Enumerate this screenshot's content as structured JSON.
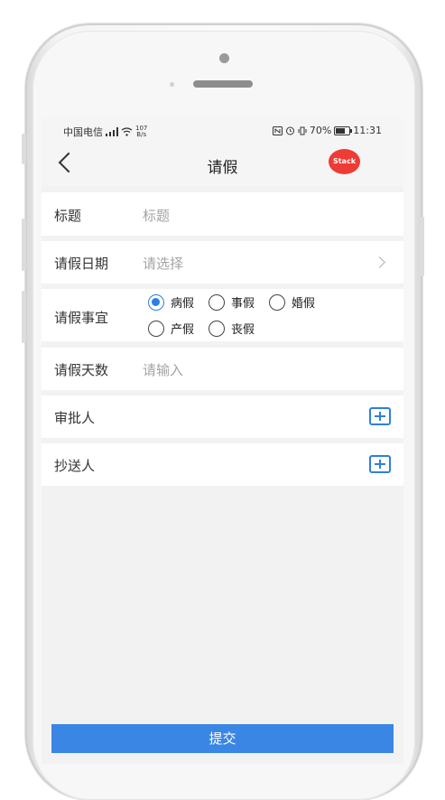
{
  "statusbar": {
    "carrier": "中国电信",
    "net_speed_value": "107",
    "net_speed_unit": "B/s",
    "icons_left": [
      "signal-icon",
      "wifi-icon"
    ],
    "icons_right": [
      "nfc-icon",
      "alarm-icon",
      "vibrate-icon"
    ],
    "battery": "70%",
    "time": "11:31"
  },
  "navbar": {
    "title": "请假",
    "badge": "Stack"
  },
  "form": {
    "title_label": "标题",
    "title_placeholder": "标题",
    "date_label": "请假日期",
    "date_placeholder": "请选择",
    "type_label": "请假事宜",
    "type_options": [
      "病假",
      "事假",
      "婚假",
      "产假",
      "丧假"
    ],
    "type_selected": "病假",
    "days_label": "请假天数",
    "days_placeholder": "请输入",
    "approver_label": "审批人",
    "cc_label": "抄送人"
  },
  "submit_label": "提交",
  "colors": {
    "accent": "#3a86e4",
    "badge": "#ee3b34"
  }
}
